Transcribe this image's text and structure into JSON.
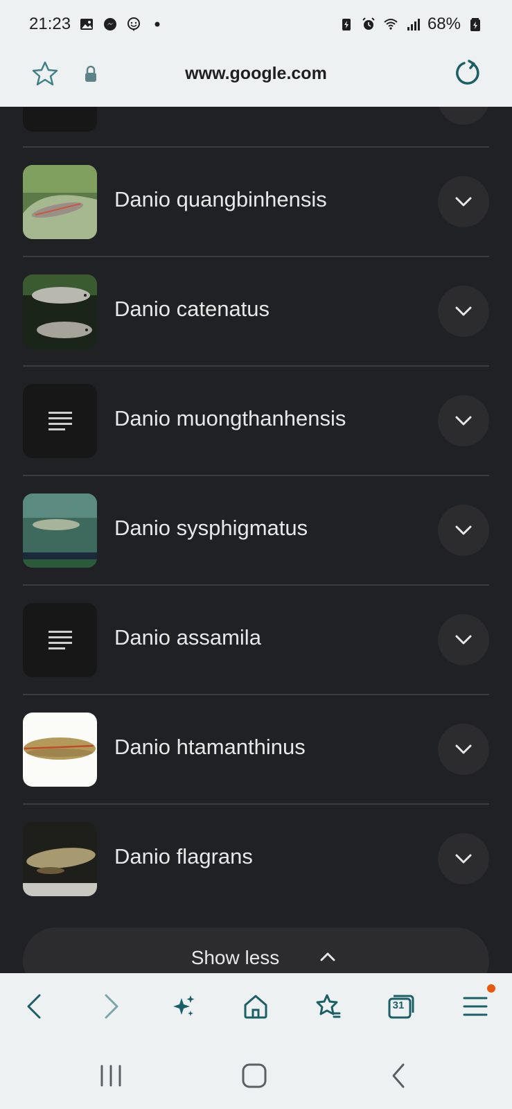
{
  "status_bar": {
    "time": "21:23",
    "battery": "68%",
    "left_icons": [
      "gallery-icon",
      "messenger-icon",
      "face-icon",
      "dot-icon"
    ],
    "right_icons": [
      "battery-saver-icon",
      "alarm-icon",
      "wifi-icon",
      "signal-icon",
      "battery-icon"
    ]
  },
  "url_bar": {
    "url": "www.google.com"
  },
  "list": {
    "items": [
      {
        "label": "Danio quangbinhensis",
        "thumb": "image"
      },
      {
        "label": "Danio catenatus",
        "thumb": "image"
      },
      {
        "label": "Danio muongthanhensis",
        "thumb": "doc"
      },
      {
        "label": "Danio sysphigmatus",
        "thumb": "image"
      },
      {
        "label": "Danio assamila",
        "thumb": "doc"
      },
      {
        "label": "Danio htamanthinus",
        "thumb": "image"
      },
      {
        "label": "Danio flagrans",
        "thumb": "image"
      }
    ],
    "show_less_label": "Show less"
  },
  "toolbar": {
    "tab_count": "31",
    "items": [
      "back",
      "forward",
      "ai-assist",
      "home",
      "bookmarks",
      "tabs",
      "menu"
    ]
  },
  "colors": {
    "page_bg": "#202124",
    "bar_bg": "#eef1f2",
    "accent": "#1a5f66",
    "notify": "#e8590c"
  }
}
